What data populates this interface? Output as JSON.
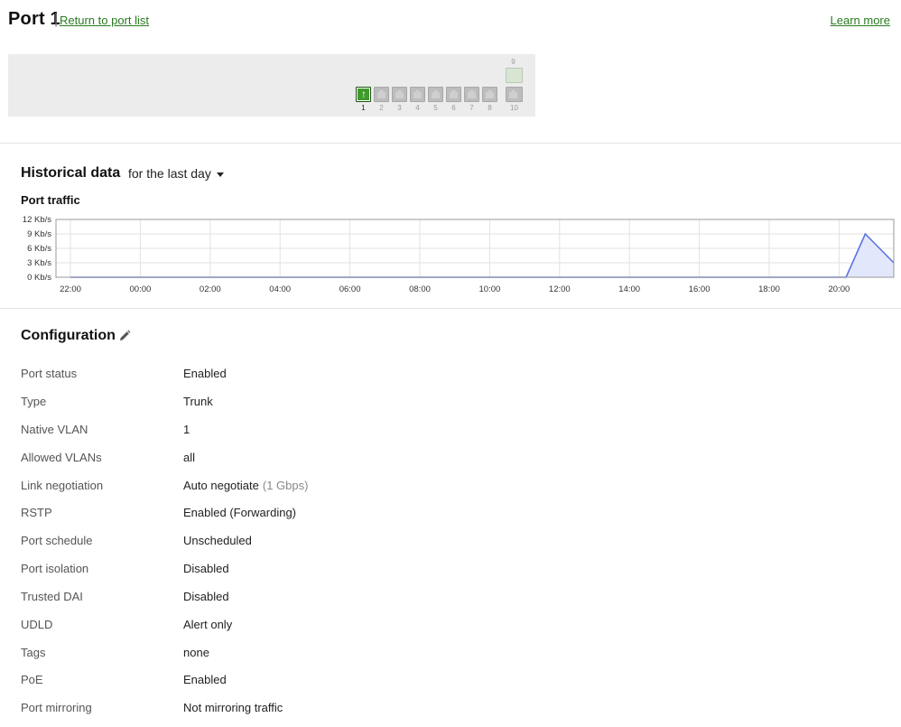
{
  "header": {
    "title": "Port 1",
    "separator": "|",
    "return_link": "Return to port list",
    "learn_more": "Learn more"
  },
  "switch_panel": {
    "ports": [
      {
        "label": "1",
        "state": "active"
      },
      {
        "label": "2",
        "state": "inactive"
      },
      {
        "label": "3",
        "state": "inactive"
      },
      {
        "label": "4",
        "state": "inactive"
      },
      {
        "label": "5",
        "state": "inactive"
      },
      {
        "label": "6",
        "state": "inactive"
      },
      {
        "label": "7",
        "state": "inactive"
      },
      {
        "label": "8",
        "state": "inactive"
      },
      {
        "label": "10",
        "state": "inactive"
      }
    ],
    "sfp_port": {
      "label": "9",
      "state": "inactive"
    },
    "active_icon": "up-arrow-icon",
    "colors": {
      "active": "#3f9a2c",
      "inactive": "#bdbdbd",
      "panel": "#ececec"
    }
  },
  "historical": {
    "title": "Historical data",
    "range": "for the last day",
    "chart_title": "Port traffic"
  },
  "chart_data": {
    "type": "area",
    "title": "Port traffic",
    "x_ticks": [
      "22:00",
      "00:00",
      "02:00",
      "04:00",
      "06:00",
      "08:00",
      "10:00",
      "12:00",
      "14:00",
      "16:00",
      "18:00",
      "20:00"
    ],
    "y_ticks": [
      "0 Kb/s",
      "3 Kb/s",
      "6 Kb/s",
      "9 Kb/s",
      "12 Kb/s"
    ],
    "ylim": [
      0,
      12
    ],
    "x_hours": [
      -2,
      20.2,
      20.75,
      21.6
    ],
    "y_values": [
      0,
      0,
      9,
      3
    ],
    "grid": true,
    "line_color": "#5b73e0",
    "fill_color": "#e3e7fb"
  },
  "configuration": {
    "title": "Configuration",
    "edit_icon": "pencil-icon",
    "rows": [
      {
        "label": "Port status",
        "value": "Enabled",
        "extra": ""
      },
      {
        "label": "Type",
        "value": "Trunk",
        "extra": ""
      },
      {
        "label": "Native VLAN",
        "value": "1",
        "extra": ""
      },
      {
        "label": "Allowed VLANs",
        "value": "all",
        "extra": ""
      },
      {
        "label": "Link negotiation",
        "value": "Auto negotiate",
        "extra": "(1 Gbps)"
      },
      {
        "label": "RSTP",
        "value": "Enabled (Forwarding)",
        "extra": ""
      },
      {
        "label": "Port schedule",
        "value": "Unscheduled",
        "extra": ""
      },
      {
        "label": "Port isolation",
        "value": "Disabled",
        "extra": ""
      },
      {
        "label": "Trusted DAI",
        "value": "Disabled",
        "extra": ""
      },
      {
        "label": "UDLD",
        "value": "Alert only",
        "extra": ""
      },
      {
        "label": "Tags",
        "value": "none",
        "extra": ""
      },
      {
        "label": "PoE",
        "value": "Enabled",
        "extra": ""
      },
      {
        "label": "Port mirroring",
        "value": "Not mirroring traffic",
        "extra": ""
      }
    ]
  }
}
